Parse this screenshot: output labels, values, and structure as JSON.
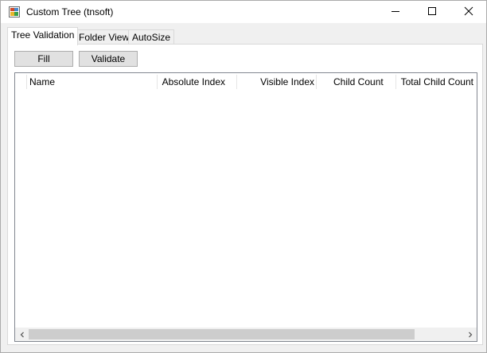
{
  "window": {
    "title": "Custom Tree (tnsoft)"
  },
  "tabs": [
    {
      "label": "Tree Validation",
      "active": true
    },
    {
      "label": "Folder View",
      "active": false
    },
    {
      "label": "AutoSize",
      "active": false
    }
  ],
  "toolbar": {
    "fill_label": "Fill",
    "validate_label": "Validate"
  },
  "list": {
    "columns": [
      "Name",
      "Absolute Index",
      "Visible Index",
      "Child Count",
      "Total Child Count"
    ],
    "rows": []
  },
  "icons": {
    "app": "app-window-icon",
    "minimize": "minimize-icon",
    "maximize": "maximize-icon",
    "close": "close-icon",
    "scroll_left": "chevron-left-icon",
    "scroll_right": "chevron-right-icon"
  }
}
